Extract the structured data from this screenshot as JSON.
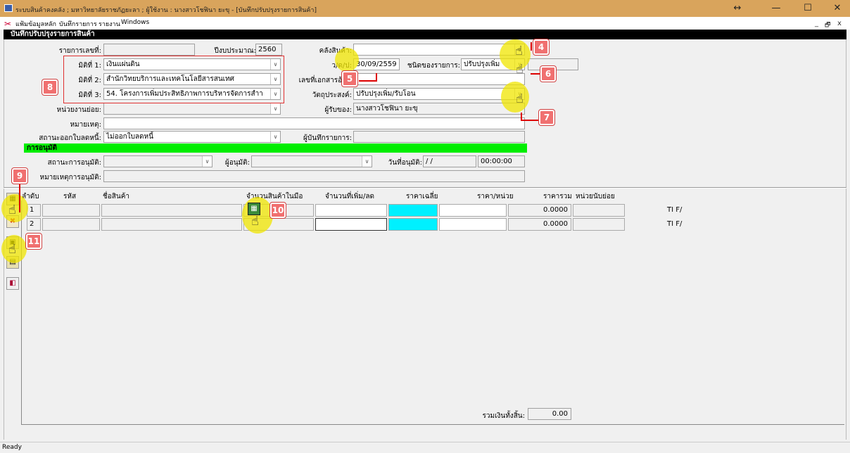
{
  "window": {
    "title": "ระบบสินค้าคงคลัง ; มหาวิทยาลัยราชภัฏยะลา ; ผู้ใช้งาน : นางสาวโชฟินา ยะขุ - [บันทึกปรับปรุงรายการสินค้า]",
    "resize_icon": "↔",
    "minimize": "—",
    "maximize": "☐",
    "close": "✕"
  },
  "menu": {
    "items": [
      "แฟ้มข้อมูลหลัก",
      "บันทึกรายการ",
      "รายงาน",
      "Windows"
    ],
    "mdi_min": "_",
    "mdi_restore": "🗗",
    "mdi_close": "x"
  },
  "form": {
    "header": "บันทึกปรับปรุงรายการสินค้า",
    "record_no_label": "รายการเลขที่:",
    "record_no": "",
    "fiscal_year_label": "ปีงบประมาณ:",
    "fiscal_year": "2560",
    "warehouse_label": "คลังสินค้า:",
    "warehouse": "",
    "dim1_label": "มิติที่ 1:",
    "dim1": "เงินแผ่นดิน",
    "dim2_label": "มิติที่ 2:",
    "dim2": "สำนักวิทยบริการและเทคโนโลยีสารสนเทศ",
    "dim3_label": "มิติที่ 3:",
    "dim3": "54. โครงการเพิ่มประสิทธิภาพการบริหารจัดการสำา",
    "date_label": "ว/ด/ป:",
    "date": "30/09/2559",
    "type_label": "ชนิดของรายการ:",
    "type": "ปรับปรุงเพิ่ม",
    "refdoc_label": "เลขที่เอกสารอ้าง:",
    "refdoc": "",
    "purpose_label": "วัตถุประสงค์:",
    "purpose": "ปรับปรุงเพิ่ม/รับโอน",
    "subunit_label": "หน่วยงานย่อย:",
    "subunit": "",
    "owner_label": "ผู้รับของ:",
    "owner": "นางสาวโชฟินา ยะขุ",
    "note_label": "หมายเหตุ:",
    "note": "",
    "debit_label": "สถานะออกใบลดหนี้:",
    "debit": "ไม่ออกใบลดหนี้",
    "recorder_label": "ผู้บันทึกรายการ:",
    "recorder": "",
    "approval_header": "การอนุมัติ",
    "approval_status_label": "สถานะการอนุมัติ:",
    "approval_status": "",
    "approver_label": "ผู้อนุมัติ:",
    "approver": "",
    "approval_date_label": "วันที่อนุมัติ:",
    "approval_date": "/ /",
    "approval_time": "00:00:00",
    "approval_note_label": "หมายเหตุการอนุมัติ:",
    "approval_note": "",
    "dropdown_arrow": "∨"
  },
  "grid": {
    "columns": [
      "ลำดับ",
      "รหัส",
      "ชื่อสินค้า",
      "จำนวนสินค้าในมือ",
      "จำนวนที่เพิ่ม/ลด",
      "ราคาเฉลี่ย",
      "ราคา/หน่วย",
      "ราคารวม",
      "หน่วยนับย่อย"
    ],
    "rows": [
      {
        "no": "1",
        "total": "0.0000",
        "tag": "TI F/"
      },
      {
        "no": "2",
        "total": "0.0000",
        "tag": "TI F/"
      }
    ],
    "grand_total_label": "รวมเงินทั้งสิ้น:",
    "grand_total": "0.00"
  },
  "annotations": {
    "c4": "4",
    "c5": "5",
    "c6": "6",
    "c7": "7",
    "c8": "8",
    "c9": "9",
    "c10": "10",
    "c11": "11",
    "hand": "☝"
  },
  "colors": {
    "highlight": "#f0e600",
    "callout": "#f07070",
    "approval_bar": "#00ee00",
    "avg_price_cell": "#00f0ff"
  },
  "status": "Ready"
}
